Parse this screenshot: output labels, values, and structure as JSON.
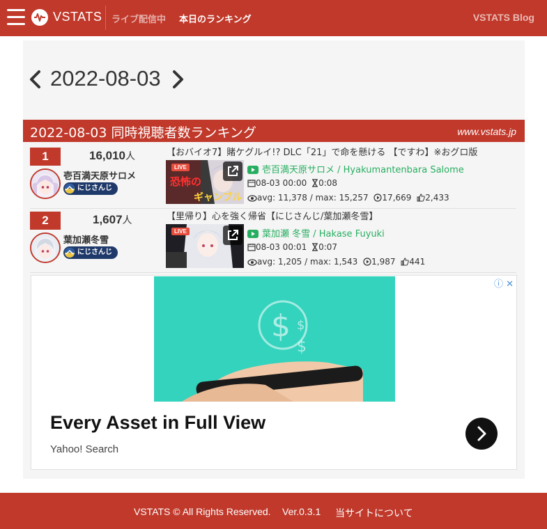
{
  "navbar": {
    "brand": "VSTATS",
    "live_link": "ライブ配信中",
    "today_link": "本日のランキング",
    "blog_link": "VSTATS Blog"
  },
  "date_nav": {
    "date": "2022-08-03"
  },
  "section": {
    "title": "2022-08-03 同時視聴者数ランキング",
    "site": "www.vstats.jp"
  },
  "rankings": [
    {
      "rank": "1",
      "viewers": "16,010",
      "unit": "人",
      "name": "壱百満天原サロメ",
      "agency": "にじさんじ",
      "title": "【おバイオ7】賭ケグルイ!? DLC「21」で命を懸ける 【ですわ】※おグロ版",
      "live_tag": "LIVE",
      "channel": "壱百満天原サロメ / Hyakumantenbara Salome",
      "start": "08-03 00:00",
      "duration": "0:08",
      "avg_max": "avg: 11,378 / max: 15,257",
      "plays": "17,669",
      "likes": "2,433"
    },
    {
      "rank": "2",
      "viewers": "1,607",
      "unit": "人",
      "name": "葉加瀬冬雪",
      "agency": "にじさんじ",
      "title": "【里帰り】心を強く帰省【にじさんじ/葉加瀬冬雪】",
      "live_tag": "LIVE",
      "channel": "葉加瀬 冬雪 / Hakase Fuyuki",
      "start": "08-03 00:01",
      "duration": "0:07",
      "avg_max": "avg: 1,205 / max: 1,543",
      "plays": "1,987",
      "likes": "441"
    }
  ],
  "ad": {
    "headline": "Every Asset in Full View",
    "source": "Yahoo! Search"
  },
  "footer": {
    "copyright": "VSTATS © All Rights Reserved.",
    "version": "Ver.0.3.1",
    "about": "当サイトについて"
  },
  "colors": {
    "brand_red": "#c0392b",
    "channel_green": "#27ae60",
    "agency_navy": "#1f3a6a"
  },
  "icons": [
    "menu-icon",
    "vstats-logo-icon",
    "chevron-left-icon",
    "chevron-right-icon",
    "youtube-icon",
    "calendar-icon",
    "hourglass-icon",
    "eye-icon",
    "play-icon",
    "thumbs-up-icon",
    "external-link-icon",
    "ad-info-icon",
    "ad-close-icon",
    "arrow-right-icon"
  ]
}
